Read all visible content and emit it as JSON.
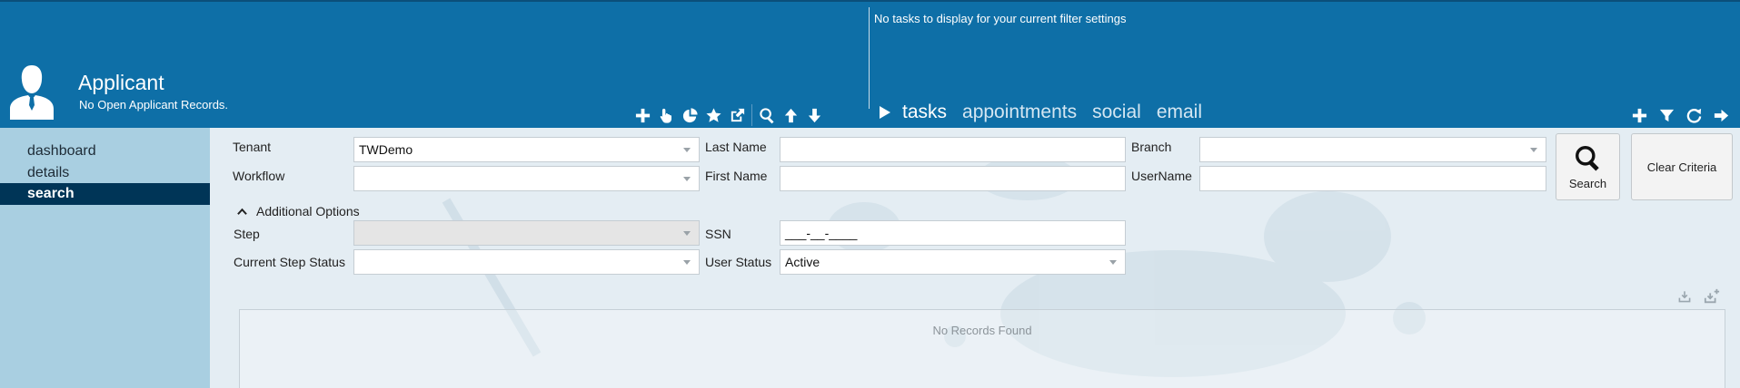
{
  "header": {
    "app_title": "Applicant",
    "app_subtitle": "No Open Applicant Records.",
    "left_tools": [
      "plus-icon",
      "hand-pointer-icon",
      "chart-pie-icon",
      "star-icon",
      "external-link-icon",
      "search-icon",
      "arrow-up-icon",
      "arrow-down-icon"
    ],
    "no_tasks_message": "No tasks to display for your current filter settings",
    "tabs": [
      {
        "label": "tasks",
        "active": true
      },
      {
        "label": "appointments",
        "active": false
      },
      {
        "label": "social",
        "active": false
      },
      {
        "label": "email",
        "active": false
      }
    ],
    "right_tools": [
      "plus-icon",
      "filter-icon",
      "refresh-icon",
      "arrow-right-icon"
    ]
  },
  "sidebar": {
    "items": [
      {
        "label": "dashboard",
        "active": false
      },
      {
        "label": "details",
        "active": false
      },
      {
        "label": "search",
        "active": true
      }
    ]
  },
  "search": {
    "tenant_label": "Tenant",
    "tenant_value": "TWDemo",
    "workflow_label": "Workflow",
    "workflow_value": "",
    "last_name_label": "Last Name",
    "last_name_value": "",
    "first_name_label": "First Name",
    "first_name_value": "",
    "branch_label": "Branch",
    "branch_value": "",
    "username_label": "UserName",
    "username_value": "",
    "search_button": "Search",
    "clear_button": "Clear Criteria",
    "additional_options": "Additional Options",
    "step_label": "Step",
    "step_value": "",
    "current_step_status_label": "Current Step Status",
    "current_step_status_value": "",
    "ssn_label": "SSN",
    "ssn_value": "___-__-____",
    "user_status_label": "User Status",
    "user_status_value": "Active"
  },
  "results": {
    "empty_message": "No Records Found"
  },
  "colors": {
    "header_bg": "#0e6fa7",
    "sidebar_bg": "#a9cfe1",
    "sidebar_active_bg": "#003557",
    "main_bg": "#e4edf3"
  }
}
